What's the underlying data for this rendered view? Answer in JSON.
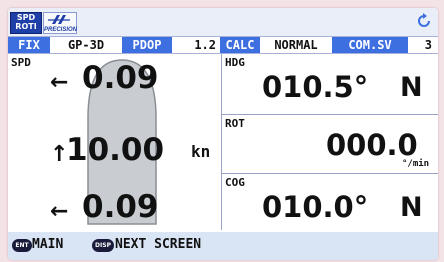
{
  "topbar": {
    "spd_icon_line1": "SPD",
    "spd_icon_line2": "ROTI",
    "logo_label": "PRECISION",
    "refresh_icon": "refresh-icon"
  },
  "status": {
    "fix_label": "FIX",
    "fix_value": "GP-3D",
    "pdop_label": "PDOP",
    "pdop_value": "1.2",
    "calc_label": "CALC",
    "calc_value": "NORMAL",
    "comsv_label": "COM.SV",
    "comsv_value": "3"
  },
  "spd": {
    "label": "SPD",
    "bow_arrow": "←",
    "bow_value": "0.09",
    "center_arrow": "↑",
    "center_value": "10.00",
    "unit": "kn",
    "stern_arrow": "←",
    "stern_value": "0.09"
  },
  "hdg": {
    "label": "HDG",
    "value": "010.5°",
    "dir": "N"
  },
  "rot": {
    "label": "ROT",
    "value": "000.0",
    "unit": "°/min"
  },
  "cog": {
    "label": "COG",
    "value": "010.0°",
    "dir": "N"
  },
  "bottom": {
    "ent_key": "ENT",
    "main_label": "MAIN",
    "disp_key": "DISP",
    "next_label": "NEXT SCREEN"
  },
  "colors": {
    "label_bg": "#3d6fe0",
    "bottom_bar": "#d9e4f4",
    "ship_fill": "#c9ccd0"
  }
}
